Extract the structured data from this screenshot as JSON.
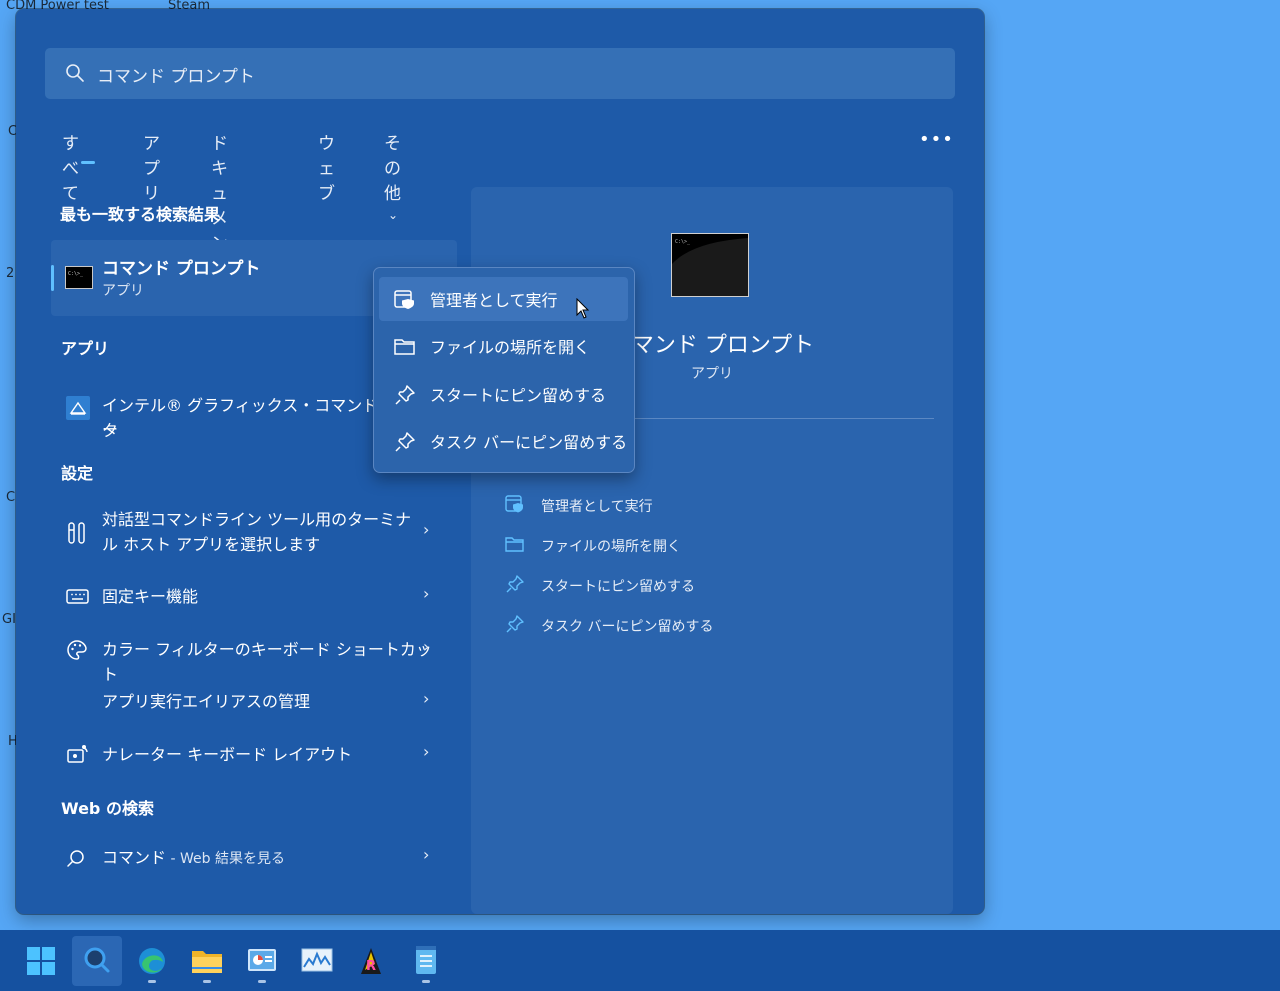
{
  "desktop": {
    "labels": [
      "CDM Power test",
      "Steam",
      "C",
      "2",
      "C",
      "GI",
      "H"
    ]
  },
  "search": {
    "query": "コマンド プロンプト",
    "icon": "search-icon"
  },
  "tabs": [
    {
      "label": "すべて",
      "selected": true
    },
    {
      "label": "アプリ"
    },
    {
      "label": "ドキュメント"
    },
    {
      "label": "ウェブ"
    },
    {
      "label": "その他"
    }
  ],
  "more_label": "•••",
  "best_match": {
    "section": "最も一致する検索結果",
    "title": "コマンド プロンプト",
    "subtitle": "アプリ"
  },
  "apps": {
    "section": "アプリ",
    "items": [
      {
        "label": "インテル® グラフィックス・コマンド・センター",
        "line1": "インテル® グラフィックス・コマンド・センタ",
        "line2": "ー"
      }
    ]
  },
  "settings": {
    "section": "設定",
    "items": [
      {
        "line1": "対話型コマンドライン ツール用のターミナ",
        "line2": "ル ホスト アプリを選択します",
        "icon": "wrench-icon"
      },
      {
        "label": "固定キー機能",
        "icon": "keyboard-icon"
      },
      {
        "label": "カラー フィルターのキーボード ショートカット",
        "icon": "palette-icon"
      },
      {
        "label": "アプリ実行エイリアスの管理",
        "icon": ""
      },
      {
        "label": "ナレーター キーボード レイアウト",
        "icon": "narrator-icon"
      }
    ]
  },
  "web": {
    "section": "Web の検索",
    "query": "コマンド",
    "suffix": " - Web 結果を見る"
  },
  "preview": {
    "title": "コマンド プロンプト",
    "subtitle": "アプリ",
    "actions": [
      {
        "label": "管理者として実行",
        "icon": "shield-icon"
      },
      {
        "label": "ファイルの場所を開く",
        "icon": "folder-icon"
      },
      {
        "label": "スタートにピン留めする",
        "icon": "pin-icon"
      },
      {
        "label": "タスク バーにピン留めする",
        "icon": "pin-icon"
      }
    ]
  },
  "context_menu": {
    "items": [
      {
        "label": "管理者として実行",
        "icon": "shield-icon",
        "hover": true
      },
      {
        "label": "ファイルの場所を開く",
        "icon": "folder-icon"
      },
      {
        "label": "スタートにピン留めする",
        "icon": "pin-icon"
      },
      {
        "label": "タスク バーにピン留めする",
        "icon": "pin-icon"
      }
    ]
  },
  "taskbar": {
    "items": [
      "start-icon",
      "search-icon",
      "edge-icon",
      "file-explorer-icon",
      "control-panel-icon",
      "resource-monitor-icon",
      "reaper-icon",
      "notepad-icon"
    ]
  }
}
